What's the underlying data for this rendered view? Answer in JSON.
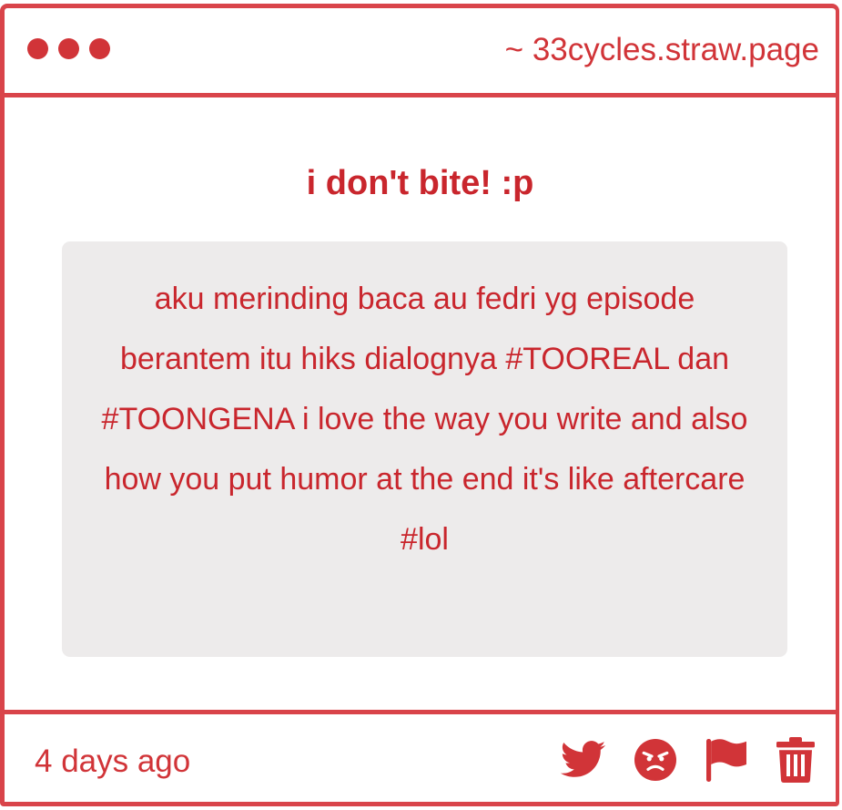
{
  "window": {
    "url": "~ 33cycles.straw.page"
  },
  "post": {
    "question": "i don't bite! :p",
    "answer": "aku merinding baca au fedri yg episode berantem itu hiks dialognya #TOOREAL dan #TOONGENA i love the way you write and also how you put humor at the end it's like aftercare #lol"
  },
  "footer": {
    "timestamp": "4 days ago",
    "actions": [
      {
        "icon": "twitter-icon"
      },
      {
        "icon": "angry-face-icon"
      },
      {
        "icon": "flag-icon"
      },
      {
        "icon": "trash-icon"
      }
    ]
  },
  "colors": {
    "accent": "#d13438",
    "border": "#d9444a",
    "answer_bg": "#edebeb",
    "background": "#ffffff"
  }
}
